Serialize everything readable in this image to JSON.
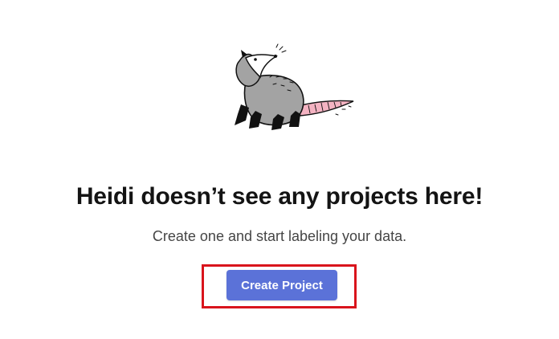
{
  "empty_state": {
    "mascot_icon": "opossum-illustration",
    "headline": "Heidi doesn’t see any projects here!",
    "subtext": "Create one and start labeling your data.",
    "create_button_label": "Create Project"
  },
  "colors": {
    "button_bg": "#5b72d8",
    "highlight_border": "#d9141c",
    "heading_text": "#141414",
    "body_text": "#454545"
  }
}
